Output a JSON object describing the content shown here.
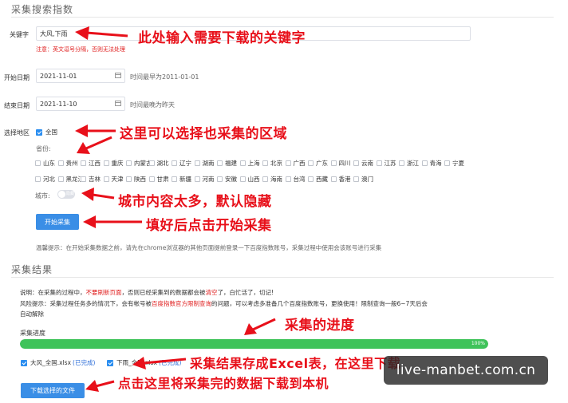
{
  "section1": {
    "title": "采集搜索指数"
  },
  "keyword": {
    "label": "关键字",
    "value": "大风,下雨",
    "note": "注意：英文逗号分隔，否则无法处理"
  },
  "start_date": {
    "label": "开始日期",
    "value": "2021-11-01",
    "hint": "时间最早为2011-01-01"
  },
  "end_date": {
    "label": "结束日期",
    "value": "2021-11-10",
    "hint": "时间最晚为昨天"
  },
  "region": {
    "label": "选择地区",
    "national": "全国",
    "province_label": "省份:",
    "row1": [
      "山东",
      "贵州",
      "江西",
      "重庆",
      "内蒙古",
      "湖北",
      "辽宁",
      "湖南",
      "福建",
      "上海",
      "北京",
      "广西",
      "广东",
      "四川",
      "云南",
      "江苏",
      "浙江",
      "青海",
      "宁夏"
    ],
    "row2": [
      "河北",
      "黑龙江",
      "吉林",
      "天津",
      "陕西",
      "甘肃",
      "新疆",
      "河南",
      "安徽",
      "山西",
      "海南",
      "台湾",
      "西藏",
      "香港",
      "澳门"
    ],
    "city_label": "城市:",
    "city_toggle": "隐藏"
  },
  "start_button": "开始采集",
  "tip": "温馨提示：在开始采集数据之前，请先在chrome浏览器的其他页面提前登录一下百度指数账号，采集过程中使用会该账号进行采集",
  "section2": {
    "title": "采集结果"
  },
  "explain": {
    "p1": "说明：在采集的过程中，",
    "p1_red": "不要刷新页面",
    "p1_rest": "，否则已经采集到的数据都会被",
    "p1_red2": "清空",
    "p1_end": "了，白忙活了，切记!",
    "risk1": "风险提示：采集过程任务多的情况下，会有帐号被",
    "risk_red": "百度指数官方限制查询",
    "risk2": "的问题，可以考虑多准备几个百度指数账号，更换使用！限制查询一般6~7天后会",
    "risk3": "自动解除"
  },
  "progress": {
    "label": "采集进度",
    "value": 100,
    "text": "100%"
  },
  "files": [
    {
      "name": "大风_全国.xlsx",
      "status": "(已完成)"
    },
    {
      "name": "下雨_全国.xlsx",
      "status": "(已完成)"
    }
  ],
  "download_button": "下载选择的文件",
  "annotations": {
    "a1": "此处输入需要下载的关键字",
    "a2": "这里可以选择也采集的区域",
    "a3": "城市内容太多，默认隐藏",
    "a4": "填好后点击开始采集",
    "a5": "采集的进度",
    "a6": "采集结果存成Excel表，在这里下载",
    "a7": "点击这里将采集完的数据下载到本机"
  },
  "watermark": "live-manbet.com.cn",
  "colors": {
    "accent": "#3a8ee6",
    "annotation": "#e8101a",
    "progress": "#3fc35a"
  }
}
